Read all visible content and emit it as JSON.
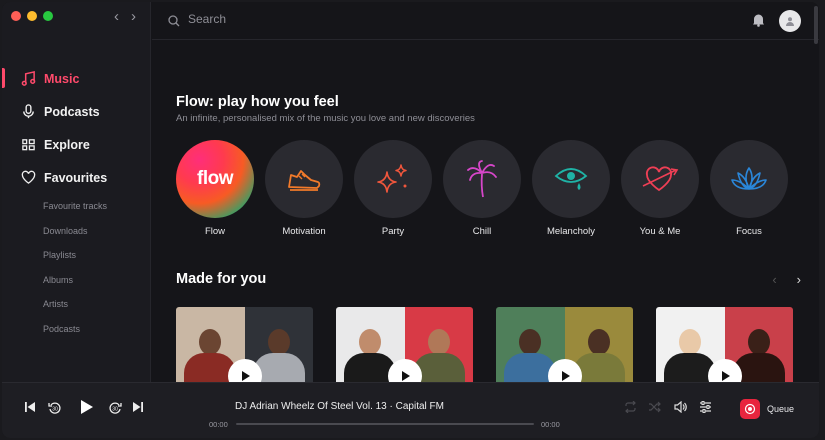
{
  "colors": {
    "accent": "#ff4a6b",
    "bg": "#151519",
    "sidebar": "#1b1b20"
  },
  "sidebar": {
    "items": [
      {
        "label": "Music",
        "icon": "music-note-icon"
      },
      {
        "label": "Podcasts",
        "icon": "microphone-icon"
      },
      {
        "label": "Explore",
        "icon": "grid-icon"
      },
      {
        "label": "Favourites",
        "icon": "heart-icon"
      }
    ],
    "sub_items": [
      "Favourite tracks",
      "Downloads",
      "Playlists",
      "Albums",
      "Artists",
      "Podcasts"
    ]
  },
  "search": {
    "placeholder": "Search"
  },
  "flow": {
    "title": "Flow: play how you feel",
    "subtitle": "An infinite, personalised mix of the music you love and new discoveries",
    "logo_text": "flow",
    "moods": [
      {
        "label": "Flow",
        "icon": "flow-logo-icon"
      },
      {
        "label": "Motivation",
        "icon": "sneaker-icon"
      },
      {
        "label": "Party",
        "icon": "sparkles-icon"
      },
      {
        "label": "Chill",
        "icon": "palm-tree-icon"
      },
      {
        "label": "Melancholy",
        "icon": "crying-eye-icon"
      },
      {
        "label": "You & Me",
        "icon": "heart-arrow-icon"
      },
      {
        "label": "Focus",
        "icon": "lotus-icon"
      }
    ]
  },
  "made_for_you": {
    "title": "Made for you"
  },
  "player": {
    "track": "DJ Adrian Wheelz Of Steel Vol. 13 · Capital FM",
    "elapsed": "00:00",
    "remaining": "00:00",
    "progress": 0,
    "queue_label": "Queue"
  }
}
